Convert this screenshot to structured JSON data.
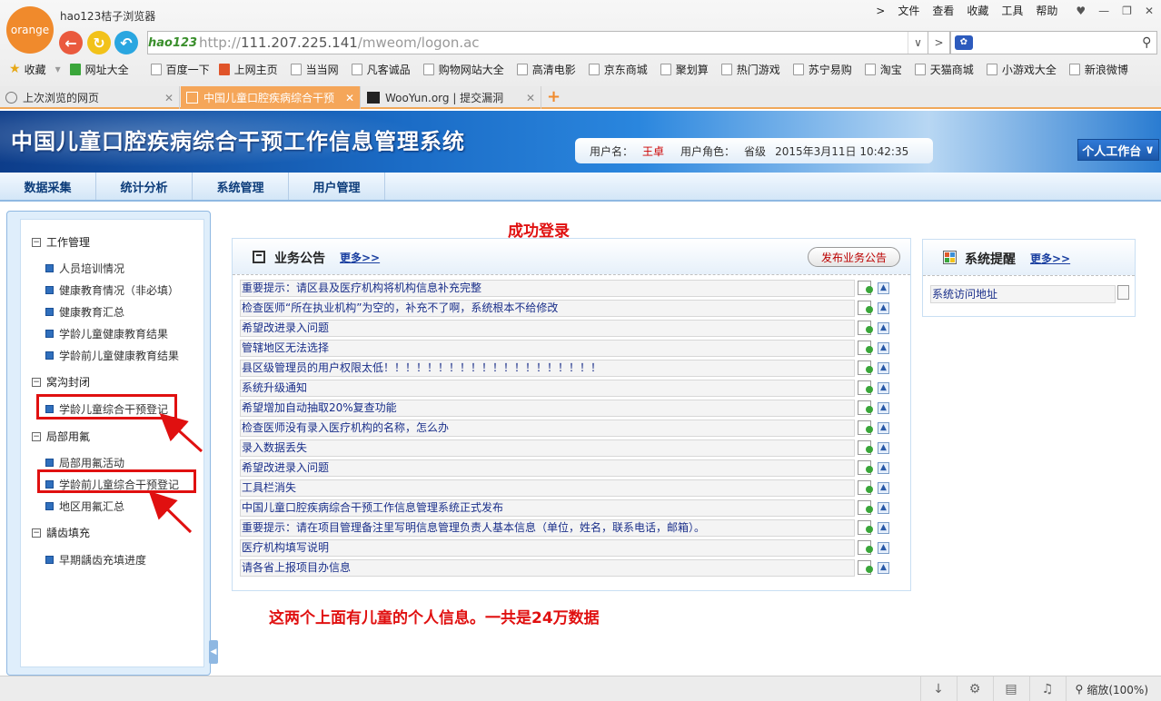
{
  "browser": {
    "logo_text": "orange",
    "app_title": "hao123桔子浏览器",
    "menu": [
      "文件",
      "查看",
      "收藏",
      "工具",
      "帮助"
    ],
    "address_logo": "hao123",
    "url_prefix": "http://",
    "url_host": "111.207.225.141",
    "url_path": "/mweom/logon.ac",
    "favorites": [
      "收藏",
      "网址大全",
      "百度一下",
      "上网主页",
      "当当网",
      "凡客诚品",
      "购物网站大全",
      "高清电影",
      "京东商城",
      "聚划算",
      "热门游戏",
      "苏宁易购",
      "淘宝",
      "天猫商城",
      "小游戏大全",
      "新浪微博"
    ],
    "tabs": [
      {
        "label": "上次浏览的网页"
      },
      {
        "label": "中国儿童口腔疾病综合干预"
      },
      {
        "label": "WooYun.org | 提交漏洞"
      }
    ],
    "zoom_label": "缩放(100%)",
    "colors": {
      "logo": "#f08a2c",
      "active_tab": "#f5a659"
    }
  },
  "app": {
    "title": "中国儿童口腔疾病综合干预工作信息管理系统",
    "user_label": "用户名：",
    "user_name": "王卓",
    "role_label": "用户角色：",
    "role": "省级",
    "datetime": "2015年3月11日  10:42:35",
    "workbench": "个人工作台",
    "nav": [
      "数据采集",
      "统计分析",
      "系统管理",
      "用户管理"
    ]
  },
  "tree": {
    "groups": [
      {
        "label": "工作管理",
        "items": [
          "人员培训情况",
          "健康教育情况（非必填）",
          "健康教育汇总",
          "学龄儿童健康教育结果",
          "学龄前儿童健康教育结果"
        ]
      },
      {
        "label": "窝沟封闭",
        "items": [
          "学龄儿童综合干预登记"
        ]
      },
      {
        "label": "局部用氟",
        "items": [
          "局部用氟活动",
          "学龄前儿童综合干预登记",
          "地区用氟汇总"
        ]
      },
      {
        "label": "龋齿填充",
        "items": [
          "早期龋齿充填进度"
        ]
      }
    ]
  },
  "annotations": {
    "login_success": "成功登录",
    "note": "这两个上面有儿童的个人信息。一共是24万数据"
  },
  "notice": {
    "title": "业务公告",
    "more": "更多>>",
    "publish": "发布业务公告",
    "rows": [
      "重要提示：请区县及医疗机构将机构信息补充完整",
      "检查医师“所在执业机构”为空的，补充不了啊，系统根本不给修改",
      "希望改进录入问题",
      "管辖地区无法选择",
      "县区级管理员的用户权限太低！！！！！！！！！！！！！！！！！！！！",
      "系统升级通知",
      "希望增加自动抽取20%复查功能",
      "检查医师没有录入医疗机构的名称，怎么办",
      "录入数据丢失",
      "希望改进录入问题",
      "工具栏消失",
      "中国儿童口腔疾病综合干预工作信息管理系统正式发布",
      "重要提示：请在项目管理备注里写明信息管理负责人基本信息（单位，姓名，联系电话，邮箱）。",
      "医疗机构填写说明",
      "请各省上报项目办信息"
    ]
  },
  "reminder": {
    "title": "系统提醒",
    "more": "更多>>",
    "rows": [
      "系统访问地址"
    ]
  }
}
